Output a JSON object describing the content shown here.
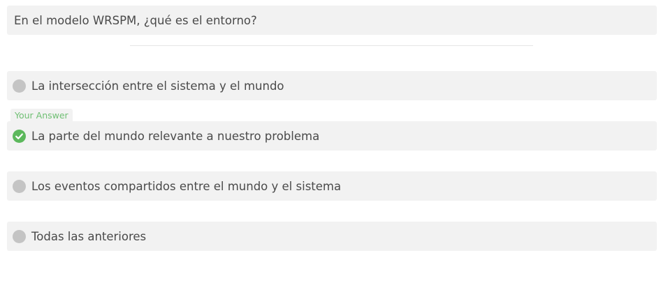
{
  "question": {
    "text": "En el modelo WRSPM, ¿qué es el entorno?"
  },
  "options": [
    {
      "text": "La intersección entre el sistema y el mundo",
      "state": "unselected",
      "icon": "radio-circle-icon"
    },
    {
      "text": "La parte del mundo relevante a nuestro problema",
      "state": "correct-selected",
      "icon": "check-circle-icon"
    },
    {
      "text": "Los eventos compartidos entre el mundo y el sistema",
      "state": "unselected",
      "icon": "radio-circle-icon"
    },
    {
      "text": "Todas las anteriores",
      "state": "unselected",
      "icon": "radio-circle-icon"
    }
  ],
  "your_answer_label": "Your Answer",
  "colors": {
    "box_background": "#f2f2f2",
    "radio_gray": "#c4c4c4",
    "correct_green": "#5cb85c",
    "label_green": "#6fbf73",
    "text": "#4a4a4a"
  }
}
